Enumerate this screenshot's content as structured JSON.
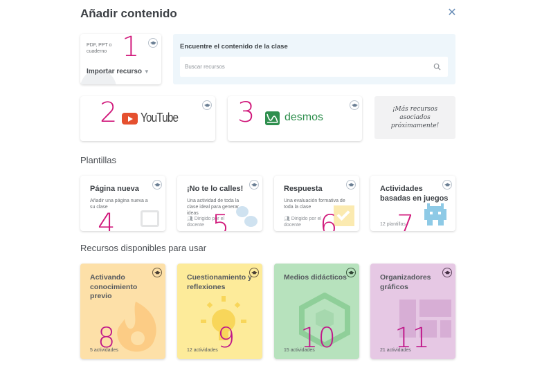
{
  "dialog": {
    "title": "Añadir contenido",
    "close_icon": "close-icon"
  },
  "import": {
    "description": "PDF, PPT o cuaderno",
    "label": "Importar recurso",
    "dropdown_icon": "▼",
    "annotation": "1"
  },
  "search": {
    "heading": "Encuentre el contenido de la clase",
    "placeholder": "Buscar recursos",
    "icon": "search-icon"
  },
  "integrations": [
    {
      "name": "YouTube",
      "annotation": "2"
    },
    {
      "name": "desmos",
      "annotation": "3"
    }
  ],
  "coming_soon": "¡Más recursos asociados próximamente!",
  "templates_section": {
    "title": "Plantillas",
    "items": [
      {
        "title": "Página nueva",
        "description": "Añadir una página nueva a su clase",
        "meta": "",
        "annotation": "4"
      },
      {
        "title": "¡No te lo calles!",
        "description": "Una actividad de toda la clase ideal para generar ideas",
        "meta": "Dirigido por el docente",
        "annotation": "5"
      },
      {
        "title": "Respuesta",
        "description": "Una evaluación formativa de toda la clase",
        "meta": "Dirigido por el docente",
        "annotation": "6"
      },
      {
        "title": "Actividades basadas en juegos",
        "description": "",
        "meta": "12 plantillas",
        "annotation": "7"
      }
    ]
  },
  "resources_section": {
    "title": "Recursos disponibles para usar",
    "items": [
      {
        "title": "Activando conocimiento previo",
        "meta": "5 actividades",
        "annotation": "8",
        "color": "#fde0a8"
      },
      {
        "title": "Cuestionamiento y reflexiones",
        "meta": "12 actividades",
        "annotation": "9",
        "color": "#fdeb9a"
      },
      {
        "title": "Medios didácticos",
        "meta": "15 actividades",
        "annotation": "10",
        "color": "#b7e2bd"
      },
      {
        "title": "Organizadores gráficos",
        "meta": "21 actividades",
        "annotation": "11",
        "color": "#e6c8e4"
      }
    ]
  },
  "colors": {
    "annotation": "#d0177a",
    "youtube_red": "#e5502f",
    "desmos_green": "#2f8f4e",
    "search_panel": "#eef6fb"
  }
}
